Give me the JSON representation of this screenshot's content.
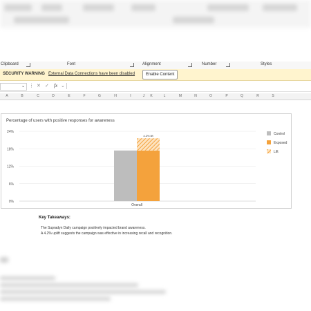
{
  "ribbon": {
    "groups": [
      {
        "label": "Clipboard",
        "launcher": true
      },
      {
        "label": "Font",
        "launcher": true
      },
      {
        "label": "Alignment",
        "launcher": true
      },
      {
        "label": "Number",
        "launcher": true
      },
      {
        "label": "Styles",
        "launcher": false
      }
    ]
  },
  "security": {
    "title": "SECURITY WARNING",
    "message": "External Data Connections have been disabled",
    "button": "Enable Content"
  },
  "formula_bar": {
    "fx": "fx",
    "cancel_icon": "close-icon",
    "enter_icon": "check-icon"
  },
  "columns": [
    "A",
    "B",
    "C",
    "D",
    "E",
    "F",
    "G",
    "H",
    "I",
    "J",
    "K",
    "L",
    "M",
    "N",
    "O",
    "P",
    "Q",
    "R",
    "S"
  ],
  "chart_data": {
    "type": "bar",
    "title": "Percentage of users with positive responses for awareness",
    "categories": [
      "Overall"
    ],
    "series": [
      {
        "name": "Control",
        "values": [
          17.4
        ],
        "color": "#bdbdbd"
      },
      {
        "name": "Exposed",
        "values": [
          17.4
        ],
        "color": "#f4a23c"
      },
      {
        "name": "Lift",
        "values": [
          4.2
        ],
        "color": "#f4a23c",
        "pattern": "hatched"
      }
    ],
    "data_labels": [
      "4.2% lift"
    ],
    "yticks": [
      "24%",
      "18%",
      "12%",
      "6%",
      "0%"
    ],
    "ylim": [
      0,
      24
    ],
    "legend": "right"
  },
  "takeaways": {
    "title": "Key Takeaways:",
    "lines": [
      "The Supradyn Daily campaign positively impacted brand awareness.",
      "A 4.2% uplift suggests the campaign was effective in increasing recall and recognition."
    ]
  }
}
